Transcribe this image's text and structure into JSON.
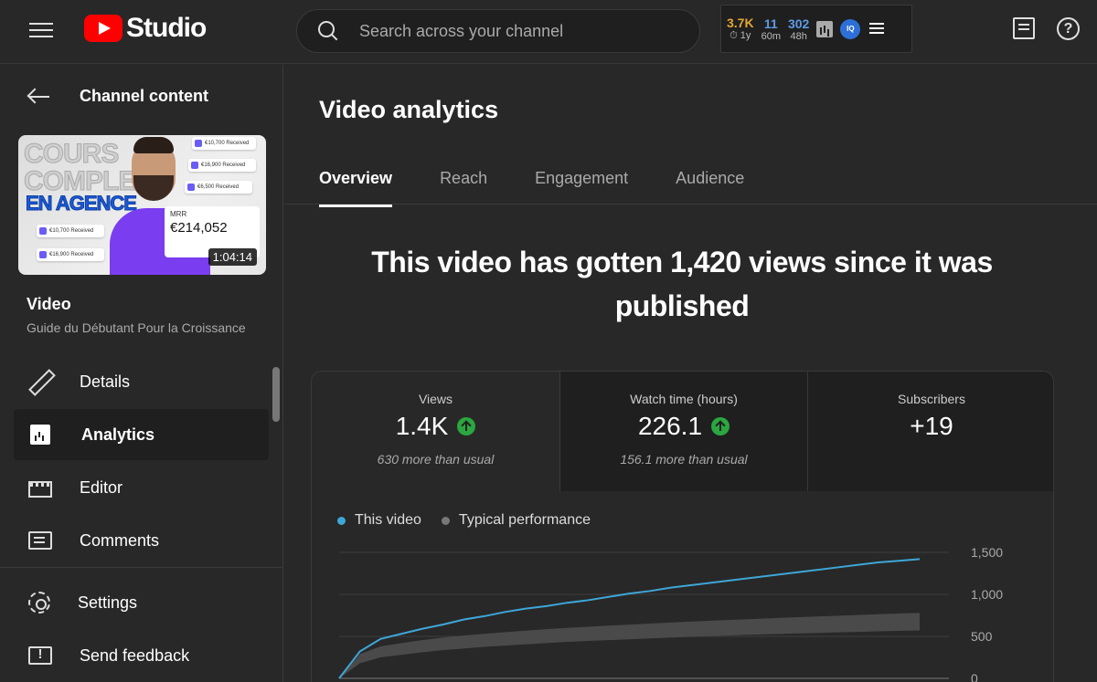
{
  "header": {
    "logo_text": "Studio",
    "search_placeholder": "Search across your channel",
    "stats": [
      {
        "value": "3.7K",
        "sub": "⏱ 1y",
        "color": "#e3a634"
      },
      {
        "value": "11",
        "sub": "60m",
        "color": "#5c9be6"
      },
      {
        "value": "302",
        "sub": "48h",
        "color": "#5c9be6"
      }
    ],
    "iq_label": "IQ"
  },
  "sidebar": {
    "back_label": "Channel content",
    "thumbnail": {
      "title_line1": "COURS",
      "title_line2": "COMPLET",
      "title_line3": "EN AGENCE",
      "cards": [
        "€10,700 Received",
        "€16,900 Received",
        "€6,500 Received",
        "€10,700 Received",
        "€16,900 Received"
      ],
      "mrr_label": "MRR",
      "mrr_value": "€214,052",
      "duration": "1:04:14"
    },
    "video_heading": "Video",
    "video_title": "Guide du Débutant Pour la Croissance",
    "items": [
      {
        "label": "Details",
        "icon": "pencil-icon"
      },
      {
        "label": "Analytics",
        "icon": "analytics-icon"
      },
      {
        "label": "Editor",
        "icon": "editor-icon"
      },
      {
        "label": "Comments",
        "icon": "comments-icon"
      }
    ],
    "bottom_items": [
      {
        "label": "Settings",
        "icon": "gear-icon"
      },
      {
        "label": "Send feedback",
        "icon": "feedback-icon"
      }
    ]
  },
  "main": {
    "title": "Video analytics",
    "tabs": [
      {
        "label": "Overview"
      },
      {
        "label": "Reach"
      },
      {
        "label": "Engagement"
      },
      {
        "label": "Audience"
      }
    ],
    "headline": "This video has gotten 1,420 views since it was published",
    "metrics": [
      {
        "label": "Views",
        "value": "1.4K",
        "note": "630 more than usual"
      },
      {
        "label": "Watch time (hours)",
        "value": "226.1",
        "note": "156.1 more than usual"
      },
      {
        "label": "Subscribers",
        "value": "+19",
        "note": ""
      }
    ],
    "legend": [
      {
        "label": "This video",
        "color": "#3ea6d8"
      },
      {
        "label": "Typical performance",
        "color": "#777777"
      }
    ]
  },
  "chart_data": {
    "type": "line",
    "yticks": [
      "1,500",
      "1,000",
      "500",
      "0"
    ],
    "ylim": [
      0,
      1500
    ],
    "series": [
      {
        "name": "This video",
        "color": "#3ea6d8",
        "values": [
          0,
          320,
          470,
          530,
          590,
          640,
          700,
          740,
          790,
          830,
          860,
          900,
          930,
          970,
          1010,
          1040,
          1080,
          1110,
          1140,
          1170,
          1200,
          1230,
          1260,
          1290,
          1320,
          1350,
          1380,
          1400,
          1420
        ]
      }
    ],
    "typical_band": {
      "name": "Typical performance",
      "low": [
        0,
        180,
        250,
        280,
        310,
        335,
        355,
        375,
        390,
        405,
        420,
        435,
        445,
        455,
        465,
        475,
        485,
        495,
        505,
        512,
        520,
        527,
        534,
        540,
        547,
        553,
        560,
        565,
        570
      ],
      "high": [
        0,
        290,
        380,
        420,
        455,
        485,
        510,
        530,
        550,
        568,
        585,
        600,
        614,
        628,
        640,
        652,
        664,
        676,
        687,
        697,
        707,
        717,
        727,
        736,
        745,
        754,
        763,
        772,
        780
      ]
    }
  }
}
